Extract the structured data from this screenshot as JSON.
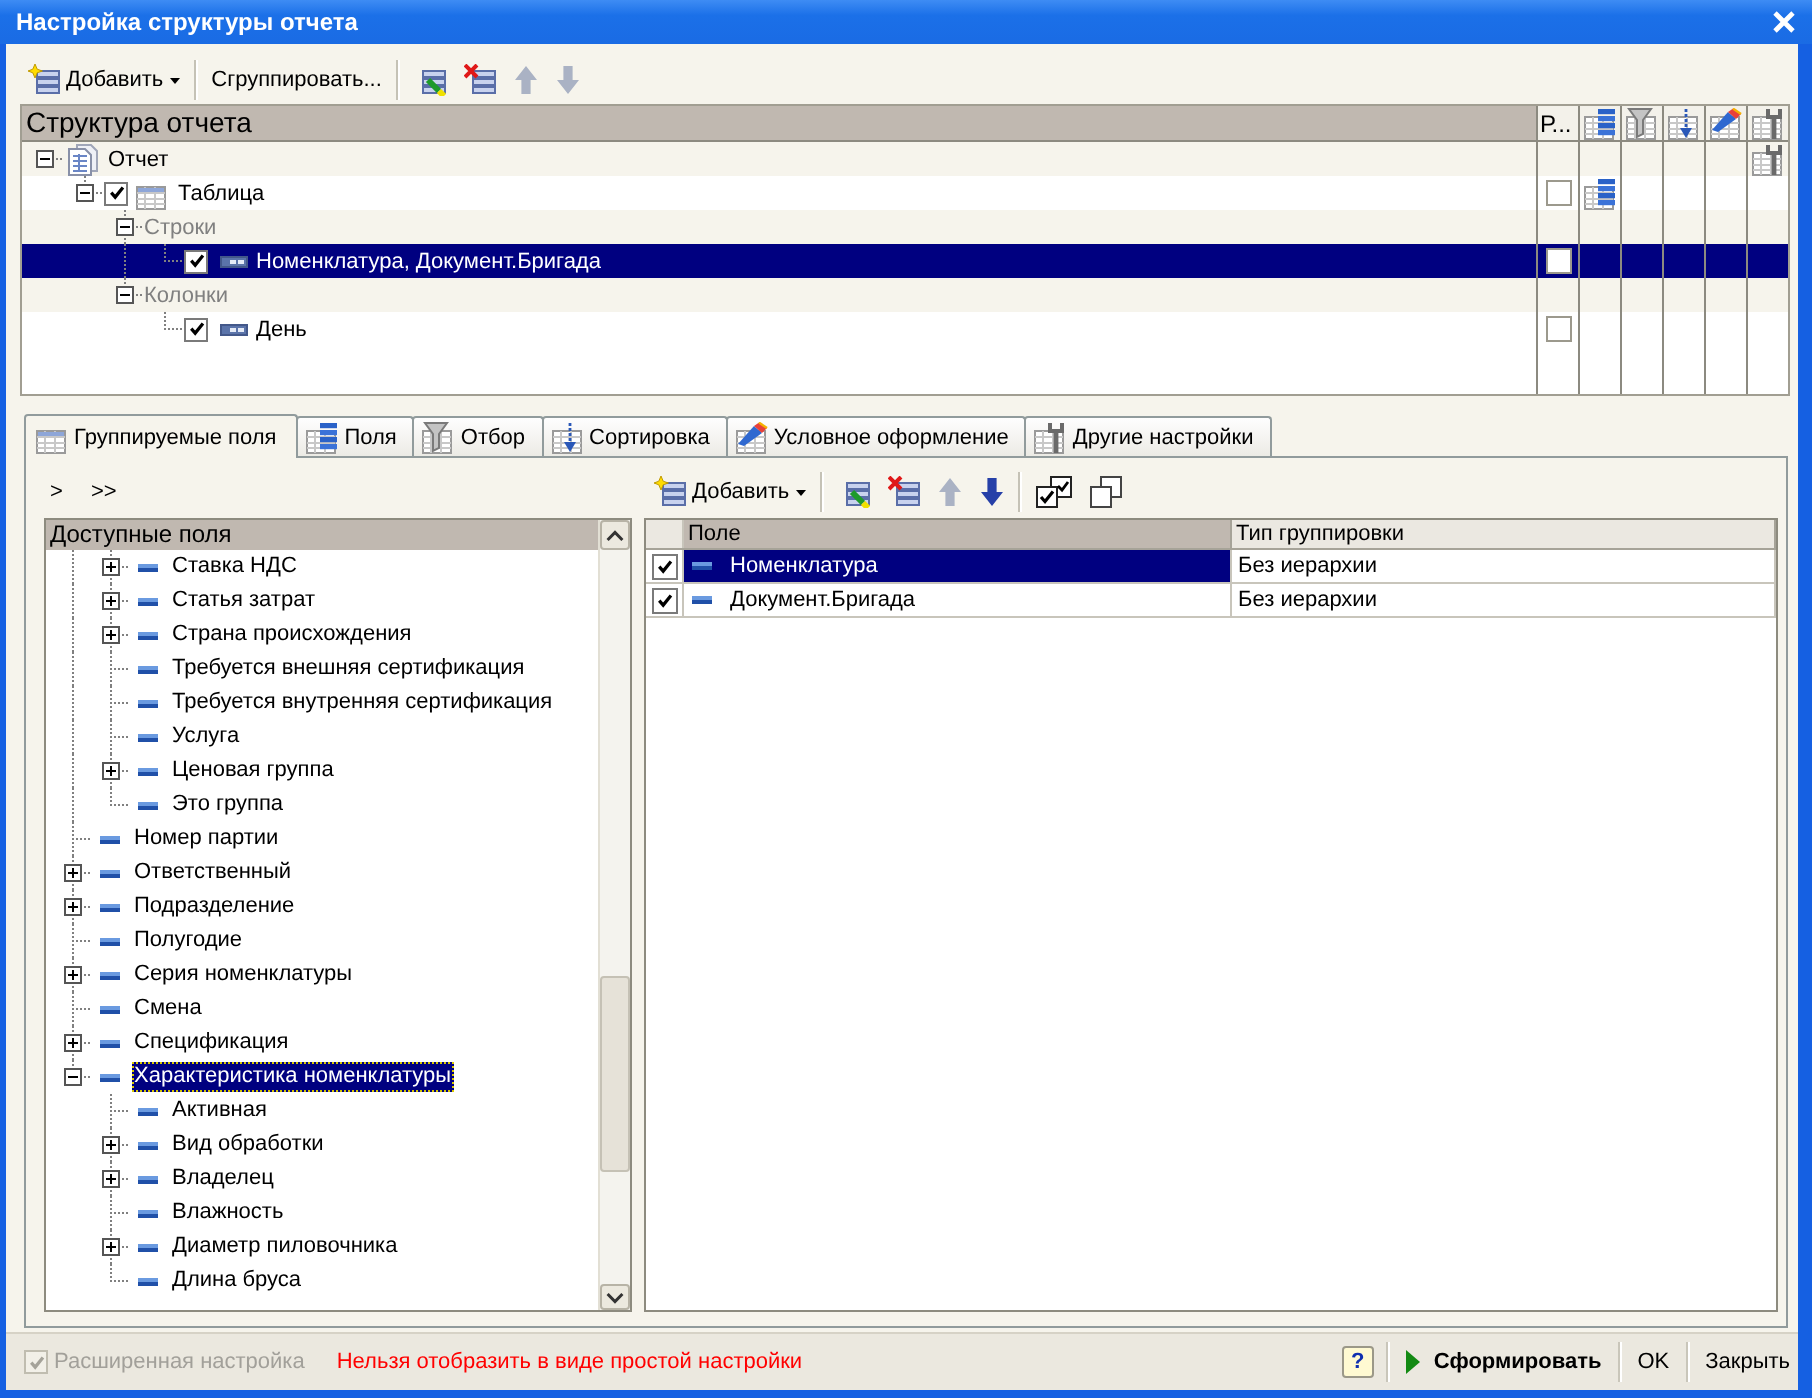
{
  "window": {
    "title": "Настройка структуры отчета"
  },
  "toolbar": {
    "groups": [
      [
        {
          "kind": "add",
          "label": "Добавить",
          "disabled": false
        }
      ],
      [
        {
          "kind": "group",
          "label": "Сгруппировать...",
          "disabled": false
        }
      ],
      [
        {
          "kind": "edit",
          "disabled": false
        },
        {
          "kind": "delete",
          "disabled": false
        },
        {
          "kind": "move_up",
          "disabled": true
        },
        {
          "kind": "move_down",
          "disabled": true
        }
      ]
    ]
  },
  "structure": {
    "title": "Структура отчета",
    "columns": [
      {
        "kind": "flag",
        "label": "Р..."
      },
      {
        "kind": "fields"
      },
      {
        "kind": "filter"
      },
      {
        "kind": "order"
      },
      {
        "kind": "appearance"
      },
      {
        "kind": "settings"
      }
    ],
    "nodes": [
      {
        "kind": "report",
        "label": "Отчет",
        "expanded": true,
        "selected": false,
        "markers": {
          "settings": true
        },
        "children": [
          {
            "kind": "table",
            "label": "Таблица",
            "expanded": true,
            "checked": true,
            "flag": false,
            "selected": false,
            "markers": {
              "fields": true
            },
            "children": [
              {
                "kind": "section",
                "label": "Строки",
                "expanded": true,
                "selected": false,
                "children": [
                  {
                    "kind": "grouping",
                    "label": "Номенклатура, Документ.Бригада",
                    "checked": true,
                    "flag": false,
                    "selected": true
                  }
                ]
              },
              {
                "kind": "section",
                "label": "Колонки",
                "expanded": true,
                "selected": false,
                "children": [
                  {
                    "kind": "grouping",
                    "label": "День",
                    "checked": true,
                    "flag": false,
                    "selected": false
                  }
                ]
              }
            ]
          }
        ]
      }
    ]
  },
  "tabs": [
    {
      "kind": "grouped_fields",
      "label": "Группируемые поля",
      "selected": true
    },
    {
      "kind": "fields",
      "label": "Поля",
      "selected": false
    },
    {
      "kind": "filter",
      "label": "Отбор",
      "selected": false
    },
    {
      "kind": "order",
      "label": "Сортировка",
      "selected": false
    },
    {
      "kind": "appearance",
      "label": "Условное оформление",
      "selected": false
    },
    {
      "kind": "settings",
      "label": "Другие настройки",
      "selected": false
    }
  ],
  "nav_buttons": [
    ">",
    ">>"
  ],
  "available_fields": {
    "title": "Доступные поля",
    "items": [
      {
        "children": [
          {
            "label": "Ставка НДС",
            "expanded": false,
            "selected": false
          },
          {
            "label": "Статья затрат",
            "expanded": false,
            "selected": false
          },
          {
            "label": "Страна происхождения",
            "expanded": false,
            "selected": false
          },
          {
            "label": "Требуется внешняя сертификация",
            "selected": false
          },
          {
            "label": "Требуется внутренняя сертификация",
            "selected": false
          },
          {
            "label": "Услуга",
            "selected": false
          },
          {
            "label": "Ценовая группа",
            "expanded": false,
            "selected": false
          },
          {
            "label": "Это группа",
            "selected": false
          }
        ]
      },
      {
        "label": "Номер партии",
        "selected": false
      },
      {
        "label": "Ответственный",
        "expanded": false,
        "selected": false
      },
      {
        "label": "Подразделение",
        "expanded": false,
        "selected": false
      },
      {
        "label": "Полугодие",
        "selected": false
      },
      {
        "label": "Серия номенклатуры",
        "expanded": false,
        "selected": false
      },
      {
        "label": "Смена",
        "selected": false
      },
      {
        "label": "Спецификация",
        "expanded": false,
        "selected": false
      },
      {
        "label": "Характеристика номенклатуры",
        "expanded": true,
        "selected": true,
        "children": [
          {
            "label": "Активная",
            "selected": false
          },
          {
            "label": "Вид обработки",
            "expanded": false,
            "selected": false
          },
          {
            "label": "Владелец",
            "expanded": false,
            "selected": false
          },
          {
            "label": "Влажность",
            "selected": false
          },
          {
            "label": "Диаметр пиловочника",
            "expanded": false,
            "selected": false
          },
          {
            "label": "Длина бруса",
            "selected": false
          }
        ]
      }
    ]
  },
  "grouped_fields": {
    "toolbar": {
      "groups": [
        [
          {
            "kind": "add",
            "label": "Добавить",
            "disabled": false
          }
        ],
        [
          {
            "kind": "edit",
            "disabled": false
          },
          {
            "kind": "delete",
            "disabled": false
          },
          {
            "kind": "move_up",
            "disabled": true
          },
          {
            "kind": "move_down",
            "disabled": false
          }
        ],
        [
          {
            "kind": "check_all",
            "disabled": false
          },
          {
            "kind": "uncheck_all",
            "disabled": false
          }
        ]
      ]
    },
    "columns": [
      {
        "label": "Поле",
        "selected": true
      },
      {
        "label": "Тип группировки",
        "selected": false
      }
    ],
    "rows": [
      {
        "checked": true,
        "field": "Номенклатура",
        "type": "Без иерархии",
        "selected": true
      },
      {
        "checked": true,
        "field": "Документ.Бригада",
        "type": "Без иерархии",
        "selected": false
      }
    ]
  },
  "status_bar": {
    "extended": {
      "label": "Расширенная настройка",
      "checked": true,
      "disabled": true
    },
    "message": "Нельзя отобразить в виде простой настройки",
    "help": "?",
    "buttons": [
      {
        "kind": "run",
        "label": "Сформировать"
      },
      {
        "kind": "plain",
        "label": "OK"
      },
      {
        "kind": "plain",
        "label": "Закрыть"
      }
    ]
  }
}
